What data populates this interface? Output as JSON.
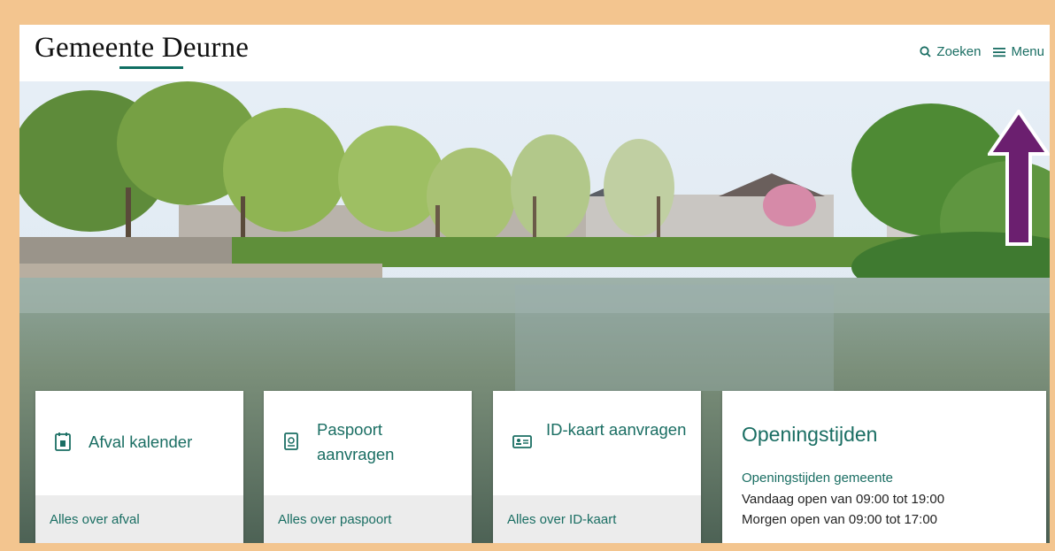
{
  "header": {
    "logo_text": "Gemeente Deurne",
    "search_label": "Zoeken",
    "menu_label": "Menu"
  },
  "tiles": [
    {
      "title": "Afval kalender",
      "link": "Alles over afval",
      "icon": "calendar-trash-icon"
    },
    {
      "title": "Paspoort aanvragen",
      "link": "Alles over paspoort",
      "icon": "passport-icon"
    },
    {
      "title": "ID-kaart aanvragen",
      "link": "Alles over ID-kaart",
      "icon": "id-card-icon"
    }
  ],
  "hours": {
    "title": "Openingstijden",
    "subtitle": "Openingstijden gemeente",
    "today": "Vandaag open van 09:00 tot 19:00",
    "tomorrow": "Morgen open van 09:00 tot 17:00"
  },
  "colors": {
    "brand": "#1a6e63",
    "frame": "#f3c58f",
    "annotation_arrow": "#6b1f6f"
  }
}
